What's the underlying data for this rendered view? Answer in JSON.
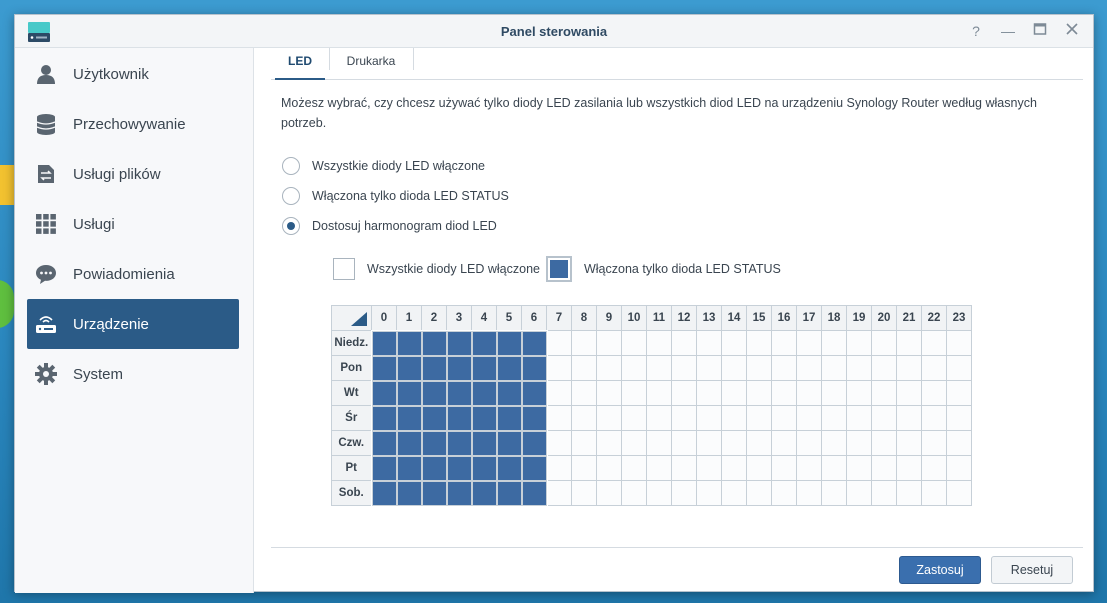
{
  "window": {
    "title": "Panel sterowania"
  },
  "window_controls": [
    "help-icon",
    "minimize-icon",
    "maximize-icon",
    "close-icon"
  ],
  "sidebar": {
    "items": [
      {
        "label": "Użytkownik",
        "icon": "user-icon",
        "active": false
      },
      {
        "label": "Przechowywanie",
        "icon": "storage-icon",
        "active": false
      },
      {
        "label": "Usługi plików",
        "icon": "file-services-icon",
        "active": false
      },
      {
        "label": "Usługi",
        "icon": "services-grid-icon",
        "active": false
      },
      {
        "label": "Powiadomienia",
        "icon": "notification-icon",
        "active": false
      },
      {
        "label": "Urządzenie",
        "icon": "router-icon",
        "active": true
      },
      {
        "label": "System",
        "icon": "gear-icon",
        "active": false
      }
    ]
  },
  "tabs": [
    {
      "label": "LED",
      "active": true
    },
    {
      "label": "Drukarka",
      "active": false
    }
  ],
  "description": "Możesz wybrać, czy chcesz używać tylko diody LED zasilania lub wszystkich diod LED na urządzeniu Synology Router według własnych potrzeb.",
  "options": [
    {
      "label": "Wszystkie diody LED włączone",
      "checked": false
    },
    {
      "label": "Włączona tylko dioda LED STATUS",
      "checked": false
    },
    {
      "label": "Dostosuj harmonogram diod LED",
      "checked": true
    }
  ],
  "legend": {
    "all_on": "Wszystkie diody LED włączone",
    "status_only": "Włączona tylko dioda LED STATUS"
  },
  "schedule": {
    "hours": [
      "0",
      "1",
      "2",
      "3",
      "4",
      "5",
      "6",
      "7",
      "8",
      "9",
      "10",
      "11",
      "12",
      "13",
      "14",
      "15",
      "16",
      "17",
      "18",
      "19",
      "20",
      "21",
      "22",
      "23"
    ],
    "days": [
      "Niedz.",
      "Pon",
      "Wt",
      "Śr",
      "Czw.",
      "Pt",
      "Sob."
    ],
    "status_only_hours": [
      0,
      1,
      2,
      3,
      4,
      5,
      6
    ]
  },
  "buttons": {
    "apply": "Zastosuj",
    "reset": "Resetuj"
  },
  "colors": {
    "accent": "#2b5b87",
    "cell_on": "#3d6aa2"
  }
}
